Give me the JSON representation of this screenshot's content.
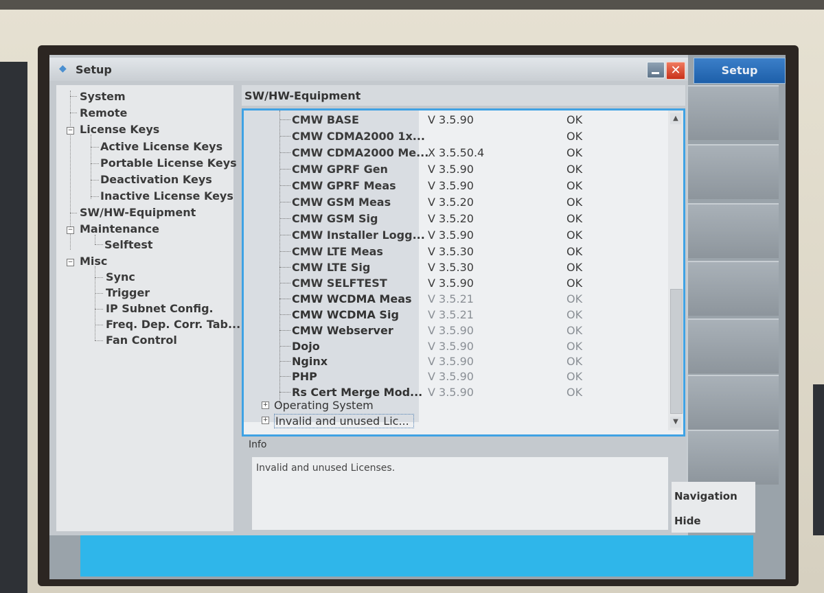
{
  "window": {
    "title": "Setup",
    "close_symbol": "✕",
    "icon": "diamond-icon"
  },
  "sidebar": {
    "items": [
      {
        "label": "System"
      },
      {
        "label": "Remote"
      },
      {
        "label": "License Keys"
      },
      {
        "label": "Active License Keys"
      },
      {
        "label": "Portable License Keys"
      },
      {
        "label": "Deactivation Keys"
      },
      {
        "label": "Inactive License Keys"
      },
      {
        "label": "SW/HW-Equipment"
      },
      {
        "label": "Maintenance"
      },
      {
        "label": "Selftest"
      },
      {
        "label": "Misc"
      },
      {
        "label": "Sync"
      },
      {
        "label": "Trigger"
      },
      {
        "label": "IP Subnet Config."
      },
      {
        "label": "Freq. Dep. Corr. Tab..."
      },
      {
        "label": "Fan Control"
      }
    ]
  },
  "panel": {
    "title": "SW/HW-Equipment",
    "rows": [
      {
        "name": "CMW BASE",
        "version": "V 3.5.90",
        "status": "OK"
      },
      {
        "name": "CMW CDMA2000 1x...",
        "version": "",
        "status": "OK"
      },
      {
        "name": "CMW CDMA2000 Me...",
        "version": "X 3.5.50.4",
        "status": "OK"
      },
      {
        "name": "CMW GPRF Gen",
        "version": "V 3.5.90",
        "status": "OK"
      },
      {
        "name": "CMW GPRF Meas",
        "version": "V 3.5.90",
        "status": "OK"
      },
      {
        "name": "CMW GSM Meas",
        "version": "V 3.5.20",
        "status": "OK"
      },
      {
        "name": "CMW GSM Sig",
        "version": "V 3.5.20",
        "status": "OK"
      },
      {
        "name": "CMW Installer Logg...",
        "version": "V 3.5.90",
        "status": "OK"
      },
      {
        "name": "CMW LTE Meas",
        "version": "V 3.5.30",
        "status": "OK"
      },
      {
        "name": "CMW LTE Sig",
        "version": "V 3.5.30",
        "status": "OK"
      },
      {
        "name": "CMW SELFTEST",
        "version": "V 3.5.90",
        "status": "OK"
      },
      {
        "name": "CMW WCDMA Meas",
        "version": "V 3.5.21",
        "status": "OK"
      },
      {
        "name": "CMW WCDMA Sig",
        "version": "V 3.5.21",
        "status": "OK"
      },
      {
        "name": "CMW Webserver",
        "version": "V 3.5.90",
        "status": "OK"
      },
      {
        "name": "Dojo",
        "version": "V 3.5.90",
        "status": "OK"
      },
      {
        "name": "Nginx",
        "version": "V 3.5.90",
        "status": "OK"
      },
      {
        "name": "PHP",
        "version": "V 3.5.90",
        "status": "OK"
      },
      {
        "name": "Rs Cert Merge Mod...",
        "version": "V 3.5.90",
        "status": "OK"
      }
    ],
    "groups": [
      {
        "label": "Operating System"
      },
      {
        "label": "Invalid and unused Lic..."
      }
    ],
    "info_label": "Info",
    "info_text": "Invalid and unused Licenses."
  },
  "softkeys": {
    "setup": "Setup",
    "navigation": "Navigation",
    "hide": "Hide"
  },
  "colors": {
    "accent": "#3fa2e4",
    "status_bar": "#2fb6ea",
    "softkey_active": "#1d5fa9"
  }
}
